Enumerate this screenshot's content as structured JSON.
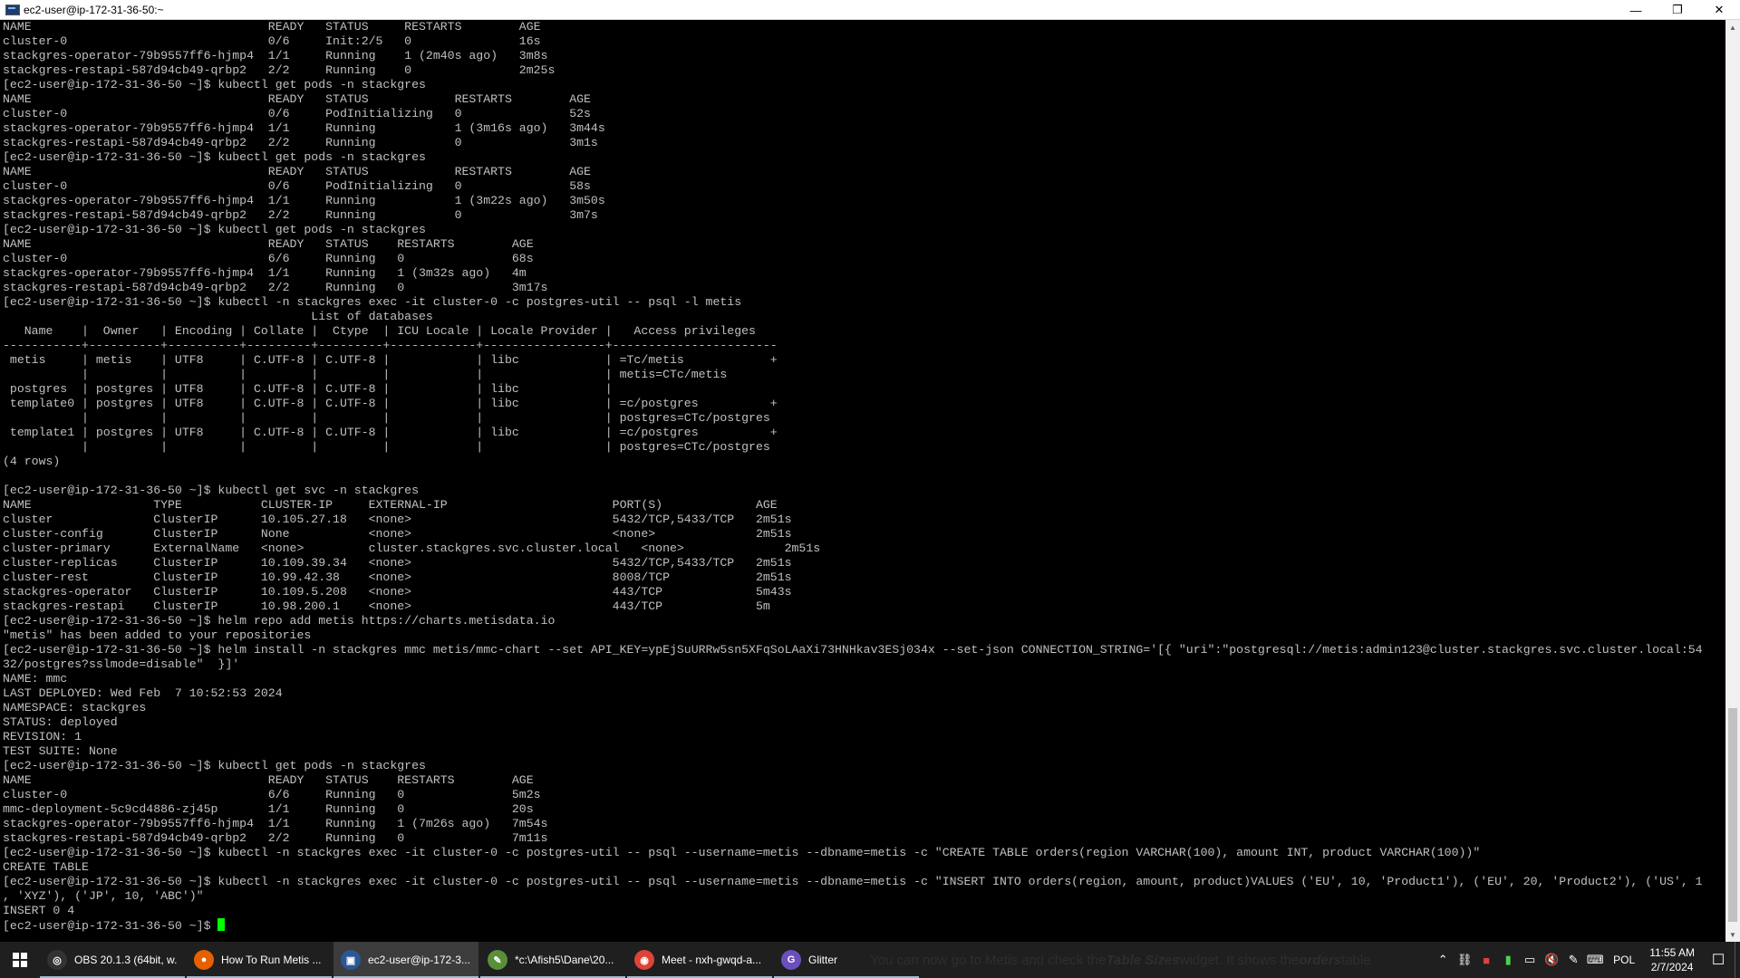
{
  "window": {
    "title": "ec2-user@ip-172-31-36-50:~",
    "controls": {
      "minimize": "—",
      "restore": "❐",
      "close": "✕"
    }
  },
  "terminal": {
    "lines": [
      "NAME                                 READY   STATUS     RESTARTS        AGE",
      "cluster-0                            0/6     Init:2/5   0               16s",
      "stackgres-operator-79b9557ff6-hjmp4  1/1     Running    1 (2m40s ago)   3m8s",
      "stackgres-restapi-587d94cb49-qrbp2   2/2     Running    0               2m25s",
      "[ec2-user@ip-172-31-36-50 ~]$ kubectl get pods -n stackgres",
      "NAME                                 READY   STATUS            RESTARTS        AGE",
      "cluster-0                            0/6     PodInitializing   0               52s",
      "stackgres-operator-79b9557ff6-hjmp4  1/1     Running           1 (3m16s ago)   3m44s",
      "stackgres-restapi-587d94cb49-qrbp2   2/2     Running           0               3m1s",
      "[ec2-user@ip-172-31-36-50 ~]$ kubectl get pods -n stackgres",
      "NAME                                 READY   STATUS            RESTARTS        AGE",
      "cluster-0                            0/6     PodInitializing   0               58s",
      "stackgres-operator-79b9557ff6-hjmp4  1/1     Running           1 (3m22s ago)   3m50s",
      "stackgres-restapi-587d94cb49-qrbp2   2/2     Running           0               3m7s",
      "[ec2-user@ip-172-31-36-50 ~]$ kubectl get pods -n stackgres",
      "NAME                                 READY   STATUS    RESTARTS        AGE",
      "cluster-0                            6/6     Running   0               68s",
      "stackgres-operator-79b9557ff6-hjmp4  1/1     Running   1 (3m32s ago)   4m",
      "stackgres-restapi-587d94cb49-qrbp2   2/2     Running   0               3m17s",
      "[ec2-user@ip-172-31-36-50 ~]$ kubectl -n stackgres exec -it cluster-0 -c postgres-util -- psql -l metis",
      "                                           List of databases",
      "   Name    |  Owner   | Encoding | Collate |  Ctype  | ICU Locale | Locale Provider |   Access privileges",
      "-----------+----------+----------+---------+---------+------------+-----------------+-----------------------",
      " metis     | metis    | UTF8     | C.UTF-8 | C.UTF-8 |            | libc            | =Tc/metis            +",
      "           |          |          |         |         |            |                 | metis=CTc/metis",
      " postgres  | postgres | UTF8     | C.UTF-8 | C.UTF-8 |            | libc            |",
      " template0 | postgres | UTF8     | C.UTF-8 | C.UTF-8 |            | libc            | =c/postgres          +",
      "           |          |          |         |         |            |                 | postgres=CTc/postgres",
      " template1 | postgres | UTF8     | C.UTF-8 | C.UTF-8 |            | libc            | =c/postgres          +",
      "           |          |          |         |         |            |                 | postgres=CTc/postgres",
      "(4 rows)",
      "",
      "[ec2-user@ip-172-31-36-50 ~]$ kubectl get svc -n stackgres",
      "NAME                 TYPE           CLUSTER-IP     EXTERNAL-IP                       PORT(S)             AGE",
      "cluster              ClusterIP      10.105.27.18   <none>                            5432/TCP,5433/TCP   2m51s",
      "cluster-config       ClusterIP      None           <none>                            <none>              2m51s",
      "cluster-primary      ExternalName   <none>         cluster.stackgres.svc.cluster.local   <none>              2m51s",
      "cluster-replicas     ClusterIP      10.109.39.34   <none>                            5432/TCP,5433/TCP   2m51s",
      "cluster-rest         ClusterIP      10.99.42.38    <none>                            8008/TCP            2m51s",
      "stackgres-operator   ClusterIP      10.109.5.208   <none>                            443/TCP             5m43s",
      "stackgres-restapi    ClusterIP      10.98.200.1    <none>                            443/TCP             5m",
      "[ec2-user@ip-172-31-36-50 ~]$ helm repo add metis https://charts.metisdata.io",
      "\"metis\" has been added to your repositories",
      "[ec2-user@ip-172-31-36-50 ~]$ helm install -n stackgres mmc metis/mmc-chart --set API_KEY=ypEjSuURRw5sn5XFqSoLAaXi73HNHkav3ESj034x --set-json CONNECTION_STRING='[{ \"uri\":\"postgresql://metis:admin123@cluster.stackgres.svc.cluster.local:54",
      "32/postgres?sslmode=disable\"  }]'",
      "NAME: mmc",
      "LAST DEPLOYED: Wed Feb  7 10:52:53 2024",
      "NAMESPACE: stackgres",
      "STATUS: deployed",
      "REVISION: 1",
      "TEST SUITE: None",
      "[ec2-user@ip-172-31-36-50 ~]$ kubectl get pods -n stackgres",
      "NAME                                 READY   STATUS    RESTARTS        AGE",
      "cluster-0                            6/6     Running   0               5m2s",
      "mmc-deployment-5c9cd4886-zj45p       1/1     Running   0               20s",
      "stackgres-operator-79b9557ff6-hjmp4  1/1     Running   1 (7m26s ago)   7m54s",
      "stackgres-restapi-587d94cb49-qrbp2   2/2     Running   0               7m11s",
      "[ec2-user@ip-172-31-36-50 ~]$ kubectl -n stackgres exec -it cluster-0 -c postgres-util -- psql --username=metis --dbname=metis -c \"CREATE TABLE orders(region VARCHAR(100), amount INT, product VARCHAR(100))\"",
      "CREATE TABLE",
      "[ec2-user@ip-172-31-36-50 ~]$ kubectl -n stackgres exec -it cluster-0 -c postgres-util -- psql --username=metis --dbname=metis -c \"INSERT INTO orders(region, amount, product)VALUES ('EU', 10, 'Product1'), ('EU', 20, 'Product2'), ('US', 1",
      ", 'XYZ'), ('JP', 10, 'ABC')\"",
      "INSERT 0 4"
    ],
    "prompt": "[ec2-user@ip-172-31-36-50 ~]$ "
  },
  "taskbar": {
    "items": [
      {
        "label": "OBS 20.1.3 (64bit, w...",
        "icon": "obs-icon",
        "color": "#333333",
        "glyph": "◎"
      },
      {
        "label": "How To Run Metis ...",
        "icon": "firefox-icon",
        "color": "#e66000",
        "glyph": "●"
      },
      {
        "label": "ec2-user@ip-172-3...",
        "icon": "putty-icon",
        "color": "#2b5797",
        "glyph": "▣",
        "active": true
      },
      {
        "label": "*c:\\Afish5\\Dane\\20...",
        "icon": "notepad-icon",
        "color": "#5a8f3a",
        "glyph": "✎"
      },
      {
        "label": "Meet - nxh-gwqd-a...",
        "icon": "chrome-icon",
        "color": "#db4437",
        "glyph": "◉"
      },
      {
        "label": "Glitter",
        "icon": "glitter-icon",
        "color": "#6b4fbb",
        "glyph": "G"
      }
    ],
    "caption": {
      "before": "You can now go to Metis and check the ",
      "bold1": "Table Sizes",
      "middle": " widget. It shows the ",
      "bold2": "orders",
      "after": " table"
    },
    "tray": {
      "icons": [
        "chevron-up-icon",
        "network-icon",
        "shield-icon",
        "battery-icon",
        "monitor-icon",
        "volume-mute-icon",
        "pen-icon",
        "keyboard-icon"
      ],
      "language": "POL",
      "time": "11:55 AM",
      "date": "2/7/2024"
    }
  }
}
